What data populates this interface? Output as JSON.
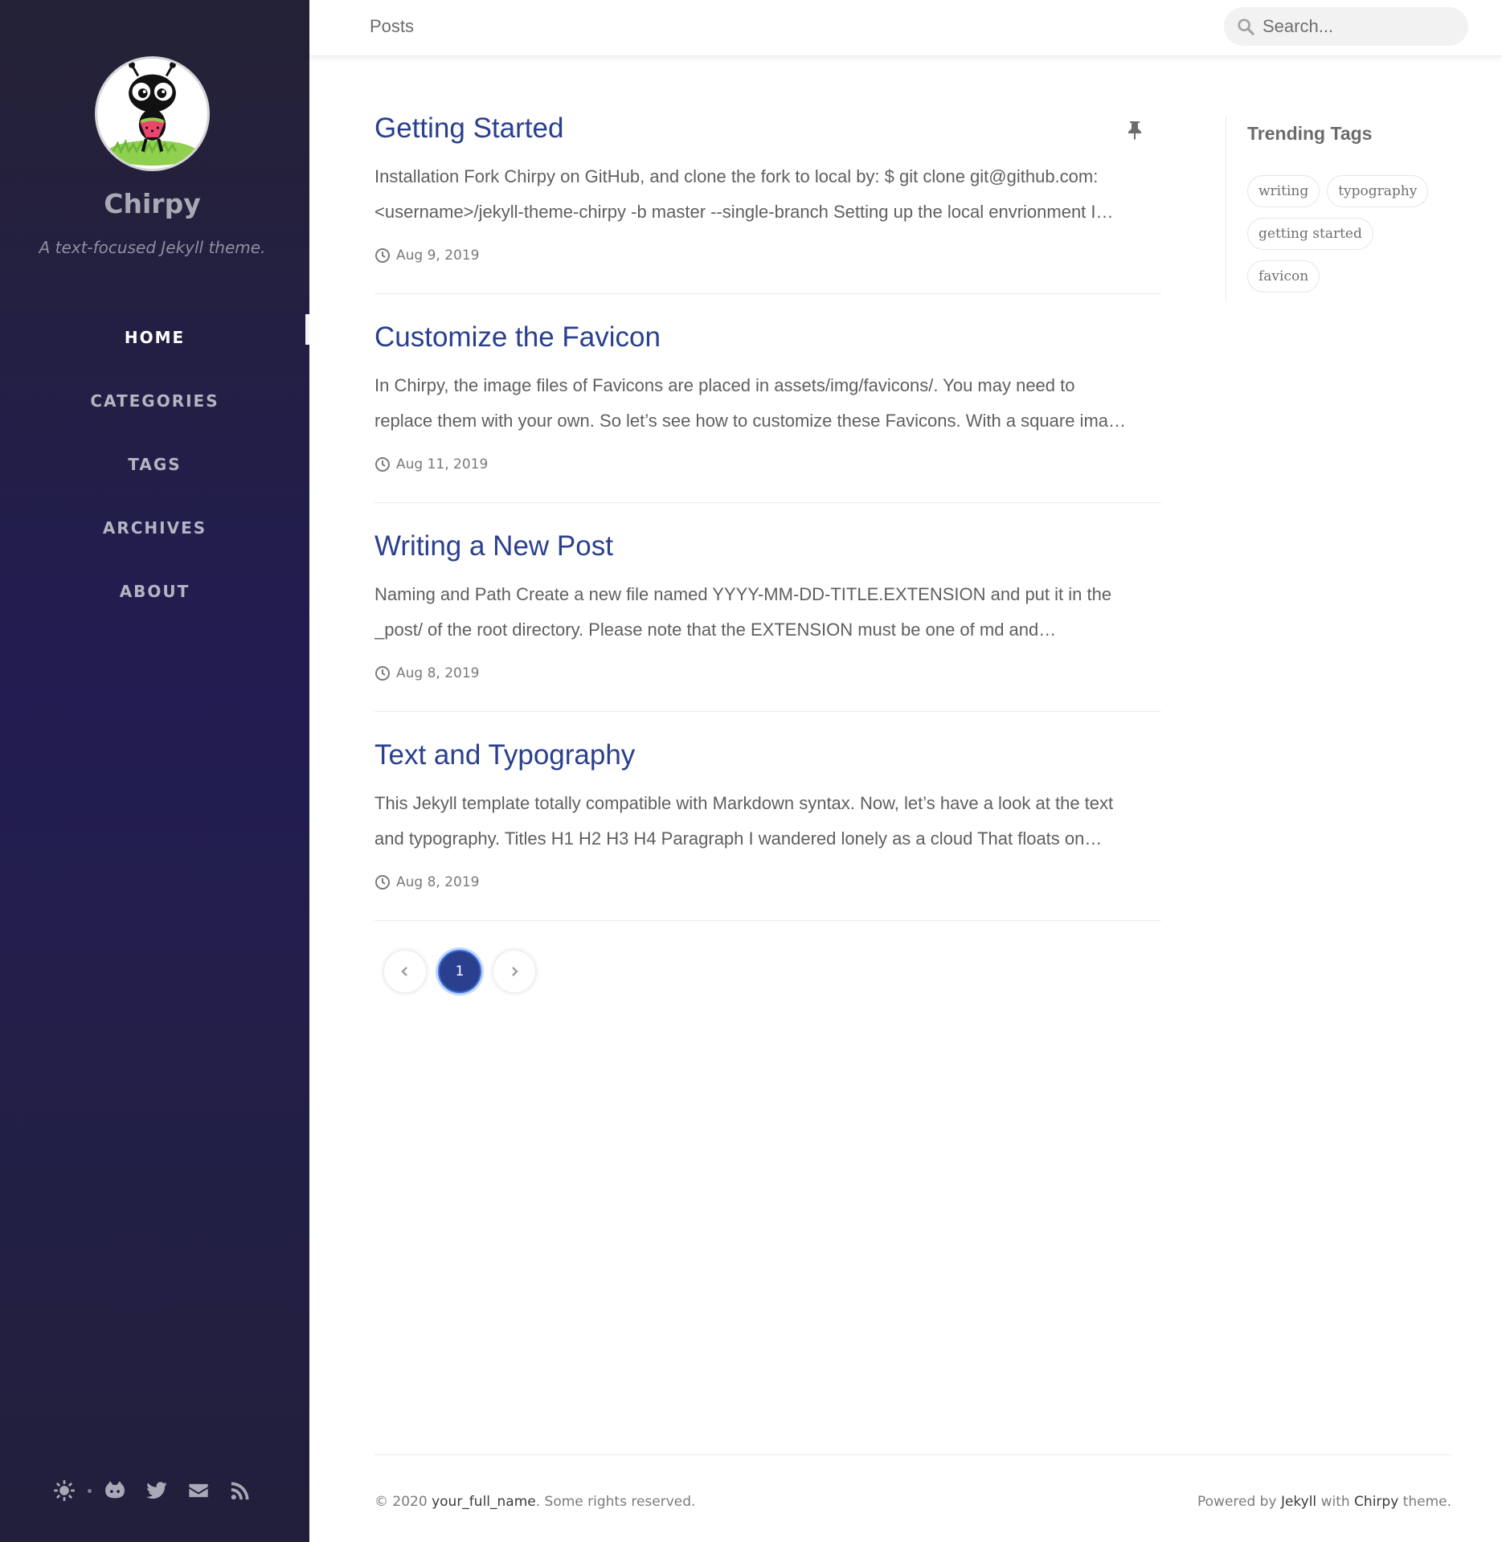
{
  "sidebar": {
    "title": "Chirpy",
    "subtitle": "A text-focused Jekyll theme.",
    "nav": [
      {
        "label": "HOME",
        "active": true
      },
      {
        "label": "CATEGORIES",
        "active": false
      },
      {
        "label": "TAGS",
        "active": false
      },
      {
        "label": "ARCHIVES",
        "active": false
      },
      {
        "label": "ABOUT",
        "active": false
      }
    ],
    "footer_icons": [
      "theme-toggle-icon",
      "github-icon",
      "twitter-icon",
      "email-icon",
      "rss-icon"
    ]
  },
  "topbar": {
    "breadcrumb": "Posts",
    "search_placeholder": "Search..."
  },
  "posts": [
    {
      "title": "Getting Started",
      "excerpt_line1": "Installation Fork Chirpy on GitHub, and clone the fork to local by: $ git clone git@github.com:",
      "excerpt_line2": "<username>/jekyll-theme-chirpy -b master --single-branch Setting up the local envrionment I…",
      "date": "Aug 9, 2019",
      "pinned": true
    },
    {
      "title": "Customize the Favicon",
      "excerpt_line1": "In Chirpy, the image files of Favicons are placed in assets/img/favicons/. You may need to",
      "excerpt_line2": "replace them with your own. So let’s see how to customize these Favicons. With a square ima…",
      "date": "Aug 11, 2019",
      "pinned": false
    },
    {
      "title": "Writing a New Post",
      "excerpt_line1": "Naming and Path Create a new file named YYYY-MM-DD-TITLE.EXTENSION and put it in the",
      "excerpt_line2": "_post/ of the root directory. Please note that the EXTENSION must be one of md and…",
      "date": "Aug 8, 2019",
      "pinned": false
    },
    {
      "title": "Text and Typography",
      "excerpt_line1": "This Jekyll template totally compatible with Markdown syntax. Now, let’s have a look at the text",
      "excerpt_line2": "and typography. Titles H1 H2 H3 H4 Paragraph I wandered lonely as a cloud That floats on…",
      "date": "Aug 8, 2019",
      "pinned": false
    }
  ],
  "pagination": {
    "current_page": "1"
  },
  "trending": {
    "heading": "Trending Tags",
    "tags": [
      "writing",
      "typography",
      "getting started",
      "favicon"
    ]
  },
  "footer": {
    "copyright_prefix": "© 2020",
    "author": "your_full_name",
    "rights": ". Some rights reserved.",
    "powered_by": "Powered by",
    "jekyll": "Jekyll",
    "with": "with",
    "chirpy": "Chirpy",
    "theme": "theme."
  },
  "colors": {
    "accent": "#2a408e",
    "sidebar_gradient_top": "#242235",
    "sidebar_gradient_mid": "#221c52"
  }
}
